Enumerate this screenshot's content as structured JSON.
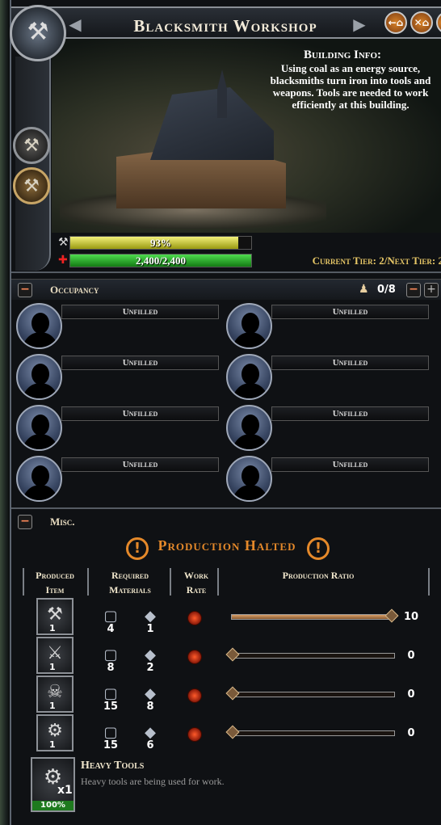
{
  "header": {
    "title": "Blacksmith Workshop",
    "buttons": [
      "←⌂",
      "✕⌂",
      "⌂"
    ]
  },
  "building_info": {
    "title": "Building Info:",
    "text": "Using coal as an energy source, blacksmiths turn iron into tools and weapons. Tools are needed to work efficiently at this building."
  },
  "condition": {
    "label": "93%",
    "fraction": 0.93
  },
  "health": {
    "label": "2,400/2,400",
    "fraction": 1.0
  },
  "tier": "Current Tier: 2/Next Tier: 2",
  "occupancy": {
    "title": "Occupancy",
    "count": "0/8",
    "slots": [
      "Unfilled",
      "Unfilled",
      "Unfilled",
      "Unfilled",
      "Unfilled",
      "Unfilled",
      "Unfilled",
      "Unfilled"
    ]
  },
  "misc": {
    "title": "Misc."
  },
  "production": {
    "status": "Production Halted",
    "columns": {
      "produced": "Produced Item",
      "materials": "Required Materials",
      "rate": "Work Rate",
      "ratio": "Production Ratio"
    },
    "rows": [
      {
        "item_icon": "pickaxe-hammer-icon",
        "item_count": "1",
        "mat1": "4",
        "mat2": "1",
        "ratio": "10",
        "ratio_fraction": 1.0
      },
      {
        "item_icon": "sword-icon",
        "item_count": "1",
        "mat1": "8",
        "mat2": "2",
        "ratio": "0",
        "ratio_fraction": 0.0
      },
      {
        "item_icon": "axe-icon",
        "item_count": "1",
        "mat1": "15",
        "mat2": "8",
        "ratio": "0",
        "ratio_fraction": 0.0
      },
      {
        "item_icon": "heavy-tools-icon",
        "item_count": "1",
        "mat1": "15",
        "mat2": "6",
        "ratio": "0",
        "ratio_fraction": 0.0
      }
    ]
  },
  "heavy_tools": {
    "title": "Heavy Tools",
    "description": "Heavy tools are being used for work.",
    "count": "x1",
    "percent": "100%"
  }
}
